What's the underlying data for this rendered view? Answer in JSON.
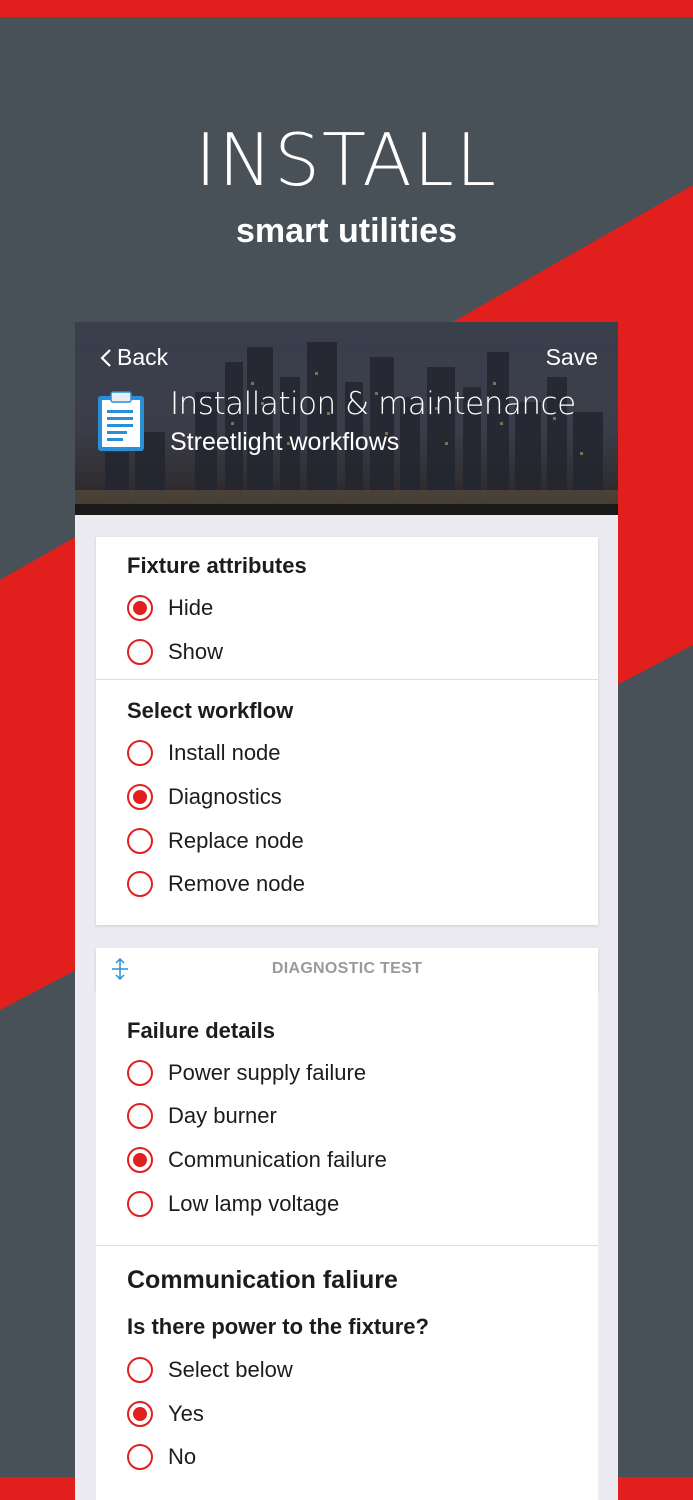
{
  "hero": {
    "title": "INSTALL",
    "subtitle": "smart utilities"
  },
  "colors": {
    "accent": "#e1201e",
    "background": "#485157",
    "card": "#ffffff",
    "muted": "#9a9a9a"
  },
  "header": {
    "back_label": "Back",
    "save_label": "Save",
    "title": "Installation & maintenance",
    "subtitle": "Streetlight workflows",
    "icon": "clipboard-icon"
  },
  "fixture_attributes": {
    "title": "Fixture attributes",
    "options": [
      {
        "label": "Hide",
        "selected": true
      },
      {
        "label": "Show",
        "selected": false
      }
    ]
  },
  "select_workflow": {
    "title": "Select workflow",
    "options": [
      {
        "label": "Install node",
        "selected": false
      },
      {
        "label": "Diagnostics",
        "selected": true
      },
      {
        "label": "Replace node",
        "selected": false
      },
      {
        "label": "Remove node",
        "selected": false
      }
    ]
  },
  "diagnostic_test": {
    "label": "DIAGNOSTIC TEST",
    "icon": "expand-collapse-icon"
  },
  "failure_details": {
    "title": "Failure details",
    "options": [
      {
        "label": "Power supply failure",
        "selected": false
      },
      {
        "label": "Day burner",
        "selected": false
      },
      {
        "label": "Communication failure",
        "selected": true
      },
      {
        "label": "Low lamp voltage",
        "selected": false
      }
    ]
  },
  "communication_failure": {
    "title": "Communication faliure",
    "question": "Is there power to the fixture?",
    "options": [
      {
        "label": "Select below",
        "selected": false
      },
      {
        "label": "Yes",
        "selected": true
      },
      {
        "label": "No",
        "selected": false
      }
    ]
  }
}
